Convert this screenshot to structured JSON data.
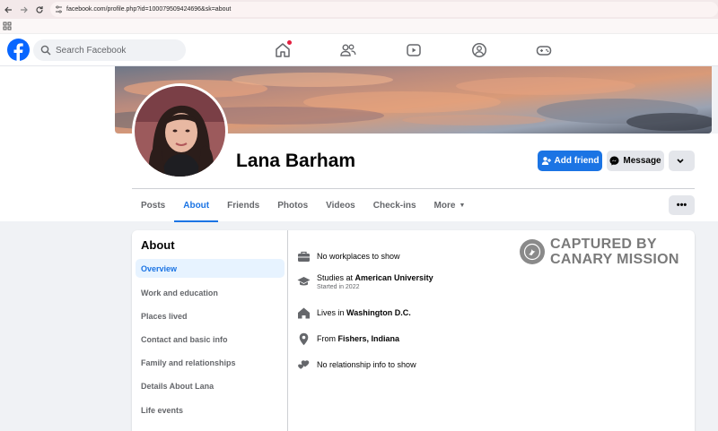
{
  "browser": {
    "url": "facebook.com/profile.php?id=100079509424696&sk=about"
  },
  "header": {
    "search_placeholder": "Search Facebook",
    "nav_icons": [
      "home-icon",
      "friends-icon",
      "watch-icon",
      "groups-icon",
      "gaming-icon"
    ]
  },
  "profile": {
    "name": "Lana Barham",
    "add_friend_label": "Add friend",
    "message_label": "Message",
    "more_label": "⌄"
  },
  "tabs": [
    {
      "label": "Posts"
    },
    {
      "label": "About"
    },
    {
      "label": "Friends"
    },
    {
      "label": "Photos"
    },
    {
      "label": "Videos"
    },
    {
      "label": "Check-ins"
    },
    {
      "label": "More"
    }
  ],
  "tabs_more_caret": "▼",
  "tabs_dots": "•••",
  "about": {
    "title": "About",
    "sidebar": [
      {
        "label": "Overview"
      },
      {
        "label": "Work and education"
      },
      {
        "label": "Places lived"
      },
      {
        "label": "Contact and basic info"
      },
      {
        "label": "Family and relationships"
      },
      {
        "label": "Details About Lana"
      },
      {
        "label": "Life events"
      }
    ],
    "overview": {
      "work": "No workplaces to show",
      "studies_prefix": "Studies at ",
      "studies_school": "American University",
      "studies_sub": "Started in 2022",
      "lives_prefix": "Lives in ",
      "lives_place": "Washington D.C.",
      "from_prefix": "From ",
      "from_place": "Fishers, Indiana",
      "relationship": "No relationship info to show"
    }
  },
  "watermark": {
    "line1": "CAPTURED BY",
    "line2": "CANARY MISSION"
  },
  "colors": {
    "accent": "#1b74e4",
    "notification": "#e41e3f"
  }
}
